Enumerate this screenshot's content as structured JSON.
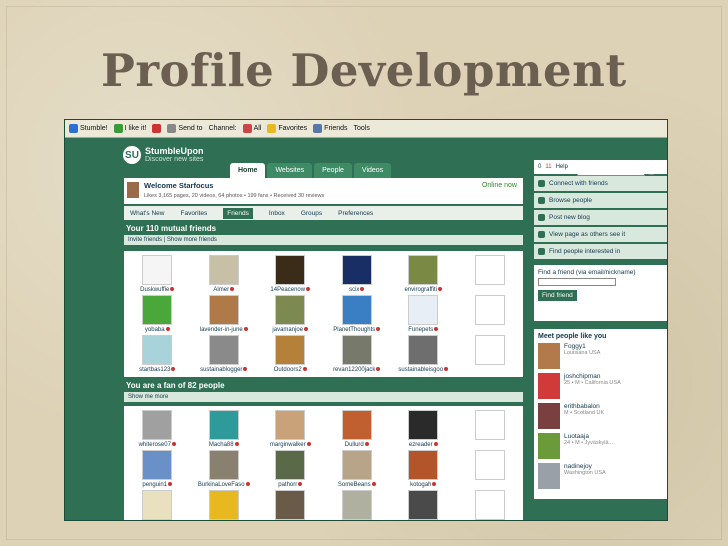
{
  "slide": {
    "title": "Profile Development"
  },
  "toolbar": {
    "items": [
      "Stumble!",
      "I like it!",
      "",
      "Send to",
      "",
      "Channel:",
      "",
      "",
      "All",
      "Favorites",
      "Friends",
      "Tools"
    ]
  },
  "site": {
    "logo_name": "StumbleUpon",
    "logo_tag": "Discover new sites",
    "tabs": [
      "Home",
      "Websites",
      "People",
      "Videos"
    ],
    "active_tab": "Home"
  },
  "welcome": {
    "title": "Welcome Starfocus",
    "stats": "Likes 3,165 pages, 20 videos, 64 photos • 199 fans • Received 30 reviews",
    "online": "Online now"
  },
  "subnav": [
    "What's New",
    "Favorites",
    "Friends",
    "Inbox",
    "Groups",
    "Preferences"
  ],
  "friends": {
    "heading": "Your 110 mutual friends",
    "links": "Invite friends  |  Show more friends",
    "people": [
      {
        "name": "Duskwuffie",
        "color": "#f5f5f5"
      },
      {
        "name": "Almer",
        "color": "#c8c0a6"
      },
      {
        "name": "14Peacenow",
        "color": "#3b2c1a"
      },
      {
        "name": "scix",
        "color": "#1a2e66"
      },
      {
        "name": "envirograffiti",
        "color": "#7a8a44"
      },
      {
        "name": "",
        "color": "#ffffff"
      },
      {
        "name": "yobaba",
        "color": "#4aa83a"
      },
      {
        "name": "lavender-in-june",
        "color": "#b07a48"
      },
      {
        "name": "javamanjoe",
        "color": "#7c8a52"
      },
      {
        "name": "PlanetThoughts",
        "color": "#3a7fc4"
      },
      {
        "name": "Funepets",
        "color": "#e8eef5"
      },
      {
        "name": "",
        "color": "#ffffff"
      },
      {
        "name": "startbas123",
        "color": "#a9d3da"
      },
      {
        "name": "sustainablogger",
        "color": "#8a8a8a"
      },
      {
        "name": "Outdoors2",
        "color": "#b4803a"
      },
      {
        "name": "revan12200jack",
        "color": "#777a6a"
      },
      {
        "name": "sustainableisgoo",
        "color": "#6e6e6e"
      },
      {
        "name": "",
        "color": "#ffffff"
      }
    ]
  },
  "fans": {
    "heading": "You are a fan of 82 people",
    "links": "Show me more",
    "people": [
      {
        "name": "whiterose07",
        "color": "#a0a0a0"
      },
      {
        "name": "Macha88",
        "color": "#2e9a9a"
      },
      {
        "name": "marginwalker",
        "color": "#c9a27a"
      },
      {
        "name": "Dullurd",
        "color": "#c06030"
      },
      {
        "name": "ezreader",
        "color": "#2a2a2a"
      },
      {
        "name": "",
        "color": "#ffffff"
      },
      {
        "name": "penguin1",
        "color": "#6a90c8"
      },
      {
        "name": "BurkinaLoveFaso",
        "color": "#8a8070"
      },
      {
        "name": "pathorr",
        "color": "#5a6a48"
      },
      {
        "name": "SomeBeans",
        "color": "#b8a488"
      },
      {
        "name": "kotogah",
        "color": "#b4542a"
      },
      {
        "name": "",
        "color": "#ffffff"
      },
      {
        "name": "",
        "color": "#e9e0c0"
      },
      {
        "name": "",
        "color": "#e8b820"
      },
      {
        "name": "",
        "color": "#6a5a48"
      },
      {
        "name": "",
        "color": "#b0b0a0"
      },
      {
        "name": "",
        "color": "#4a4a4a"
      },
      {
        "name": "",
        "color": "#ffffff"
      }
    ]
  },
  "side": {
    "top": [
      "0",
      "11",
      "Help"
    ],
    "links": [
      "Connect with friends",
      "Browse people",
      "Post new blog",
      "View page as others see it",
      "Find people interested in"
    ],
    "find": {
      "title": "Find a friend (via email/nickname)",
      "button": "Find friend"
    },
    "meet": {
      "title": "Meet people like you",
      "people": [
        {
          "name": "Foggy1",
          "loc": "Louisiana USA",
          "color": "#b27a4a"
        },
        {
          "name": "joshchipman",
          "loc": "25 • M • California USA",
          "color": "#d23a3a"
        },
        {
          "name": "erithbabalon",
          "loc": "M • Scotland UK",
          "color": "#7a4040"
        },
        {
          "name": "Luotaaja",
          "loc": "24 • M • Jyväskylä...",
          "color": "#6a9a3a"
        },
        {
          "name": "nadinejoy",
          "loc": "Washington USA",
          "color": "#9aa0a8"
        }
      ]
    }
  }
}
